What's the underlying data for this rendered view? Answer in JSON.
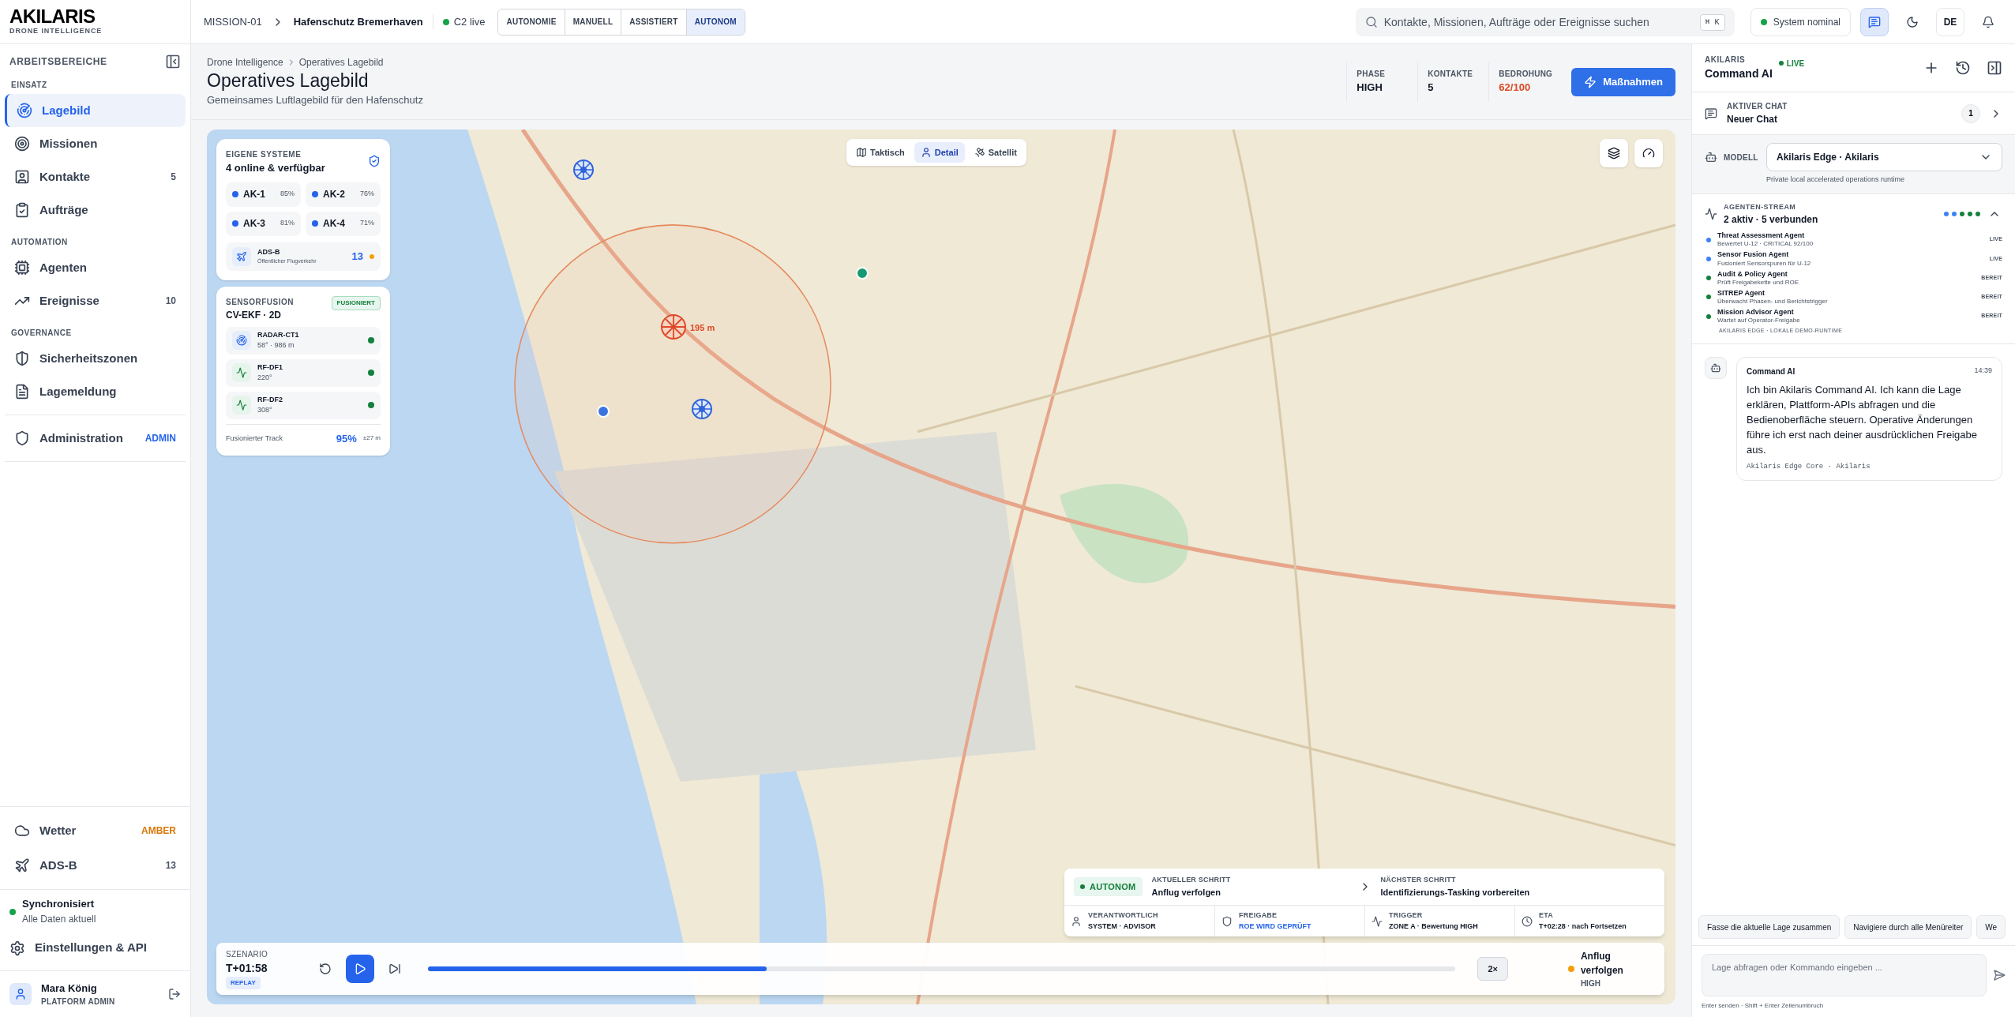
{
  "brand": {
    "name": "AKILARIS",
    "tagline": "DRONE INTELLIGENCE"
  },
  "sidebar": {
    "title": "ARBEITSBEREICHE",
    "sections": [
      {
        "label": "EINSATZ",
        "items": [
          {
            "label": "Lagebild",
            "selected": true
          },
          {
            "label": "Missionen",
            "selected": false
          },
          {
            "label": "Kontakte",
            "selected": false,
            "badge": {
              "text": "5",
              "color": "#4b5563"
            }
          },
          {
            "label": "Aufträge",
            "selected": false
          }
        ]
      },
      {
        "label": "AUTOMATION",
        "items": [
          {
            "label": "Agenten",
            "selected": false
          },
          {
            "label": "Ereignisse",
            "selected": false,
            "badge": {
              "text": "10",
              "color": "#4b5563"
            }
          }
        ]
      },
      {
        "label": "GOVERNANCE",
        "items": [
          {
            "label": "Sicherheitszonen",
            "selected": false
          },
          {
            "label": "Lagemeldung",
            "selected": false
          }
        ]
      }
    ],
    "admin": {
      "label": "Administration",
      "selected": false,
      "badge": {
        "text": "ADMIN",
        "color": "#2563eb"
      }
    },
    "bottom_items": [
      {
        "label": "Wetter",
        "badge": {
          "text": "AMBER",
          "color": "#d97706"
        }
      },
      {
        "label": "ADS-B",
        "badge": {
          "text": "13",
          "color": "#4b5563"
        }
      }
    ],
    "sync": {
      "title": "Synchronisiert",
      "subtitle": "Alle Daten aktuell",
      "color": "#16a34a"
    },
    "settings": "Einstellungen & API",
    "user": {
      "name": "Mara König",
      "role": "PLATFORM ADMIN"
    }
  },
  "topbar": {
    "mission": "MISSION-01",
    "name": "Hafenschutz Bremerhaven",
    "link": {
      "label": "C2 live",
      "color": "#16a34a"
    },
    "modes": [
      {
        "label": "AUTONOMIE",
        "selected": false
      },
      {
        "label": "MANUELL",
        "selected": false
      },
      {
        "label": "ASSISTIERT",
        "selected": false
      },
      {
        "label": "AUTONOM",
        "selected": true
      }
    ],
    "search": {
      "placeholder": "Kontakte, Missionen, Aufträge oder Ereignisse suchen",
      "shortcut": "⌘ K"
    },
    "system": {
      "label": "System nominal",
      "color": "#16a34a"
    },
    "chat_open": true,
    "language": "DE"
  },
  "header": {
    "breadcrumb": [
      "Drone Intelligence",
      "Operatives Lagebild"
    ],
    "title": "Operatives Lagebild",
    "subtitle": "Gemeinsames Luftlagebild für den Hafenschutz",
    "stats": [
      {
        "label": "PHASE",
        "value": "HIGH",
        "color": "#111827"
      },
      {
        "label": "KONTAKTE",
        "value": "5",
        "color": "#111827"
      },
      {
        "label": "BEDROHUNG",
        "value": "62/100",
        "color": "#dc4a26"
      }
    ],
    "action": "Maßnahmen"
  },
  "map": {
    "views": [
      {
        "label": "Taktisch",
        "selected": false
      },
      {
        "label": "Detail",
        "selected": true
      },
      {
        "label": "Satellit",
        "selected": false
      }
    ],
    "threat_label": "195 m",
    "own_systems": {
      "title": "EIGENE SYSTEME",
      "subtitle": "4 online & verfügbar",
      "drones": [
        {
          "name": "AK-1",
          "battery": "85%"
        },
        {
          "name": "AK-2",
          "battery": "76%"
        },
        {
          "name": "AK-3",
          "battery": "81%"
        },
        {
          "name": "AK-4",
          "battery": "71%"
        }
      ],
      "adsb": {
        "label": "ADS-B",
        "description": "Öffentlicher Flugverkehr",
        "count": "13",
        "color": "#f59e0b"
      }
    },
    "sensor_fusion": {
      "title": "SENSORFUSION",
      "subtitle": "CV-EKF · 2D",
      "badge": "FUSIONIERT",
      "sensors": [
        {
          "kind": "radar",
          "name": "RADAR-CT1",
          "reading": "58° · 986 m",
          "color": "#15803d"
        },
        {
          "kind": "rf",
          "name": "RF-DF1",
          "reading": "220°",
          "color": "#15803d"
        },
        {
          "kind": "rf",
          "name": "RF-DF2",
          "reading": "308°",
          "color": "#15803d"
        }
      ],
      "track_label": "Fusionierter Track",
      "track_value": "95%",
      "track_error": "±27 m"
    },
    "step": {
      "mode": "AUTONOM",
      "current_label": "AKTUELLER SCHRITT",
      "current": "Anflug verfolgen",
      "next_label": "NÄCHSTER SCHRITT",
      "next": "Identifizierungs-Tasking vorbereiten",
      "details": [
        {
          "label": "VERANTWORTLICH",
          "value": "SYSTEM · ADVISOR",
          "color": "#111827"
        },
        {
          "label": "FREIGABE",
          "value": "ROE WIRD GEPRÜFT",
          "color": "#2563eb"
        },
        {
          "label": "TRIGGER",
          "value": "ZONE A · Bewertung HIGH",
          "color": "#111827"
        },
        {
          "label": "ETA",
          "value": "T+02:28 · nach Fortsetzen",
          "color": "#111827"
        }
      ]
    },
    "scenario": {
      "label": "SZENARIO",
      "time": "T+01:58",
      "badge": "REPLAY",
      "level": 0.33,
      "speed": "2×",
      "status": "Anflug verfolgen",
      "severity": "HIGH",
      "color": "#f59e0b"
    }
  },
  "assistant": {
    "brand": "AKILARIS",
    "title": "Command AI",
    "live": "LIVE",
    "chat": {
      "label": "AKTIVER CHAT",
      "name": "Neuer Chat",
      "count": "1"
    },
    "model": {
      "label": "MODELL",
      "value": "Akilaris Edge · Akilaris",
      "hint": "Private local accelerated operations runtime"
    },
    "stream": {
      "label": "AGENTEN-STREAM",
      "summary": "2 aktiv · 5 verbunden",
      "expanded": true,
      "agents": [
        {
          "name": "Threat Assessment Agent",
          "task": "Bewertet U-12 · CRITICAL 92/100",
          "status": "LIVE",
          "color": "#3b82f6"
        },
        {
          "name": "Sensor Fusion Agent",
          "task": "Fusioniert Sensorspuren für U-12",
          "status": "LIVE",
          "color": "#3b82f6"
        },
        {
          "name": "Audit & Policy Agent",
          "task": "Prüft Freigabekette und ROE",
          "status": "BEREIT",
          "color": "#15803d"
        },
        {
          "name": "SITREP Agent",
          "task": "Überwacht Phasen- und Berichtstrigger",
          "status": "BEREIT",
          "color": "#15803d"
        },
        {
          "name": "Mission Advisor Agent",
          "task": "Wartet auf Operator-Freigabe",
          "status": "BEREIT",
          "color": "#15803d"
        }
      ],
      "footer": "AKILARIS EDGE · LOKALE DEMO-RUNTIME"
    },
    "messages": [
      {
        "author": "Command AI",
        "time": "14:39",
        "text": "Ich bin Akilaris Command AI. Ich kann die Lage erklären, Plattform-APIs abfragen und die Bedienoberfläche steuern. Operative Änderungen führe ich erst nach deiner ausdrücklichen Freigabe aus.",
        "source": "Akilaris Edge Core · Akilaris"
      }
    ],
    "suggestions": [
      "Fasse die aktuelle Lage zusammen",
      "Navigiere durch alle Menüreiter",
      "We"
    ],
    "input": {
      "placeholder": "Lage abfragen oder Kommando eingeben ...",
      "hint": "Enter senden · Shift + Enter Zeilenumbruch"
    }
  }
}
